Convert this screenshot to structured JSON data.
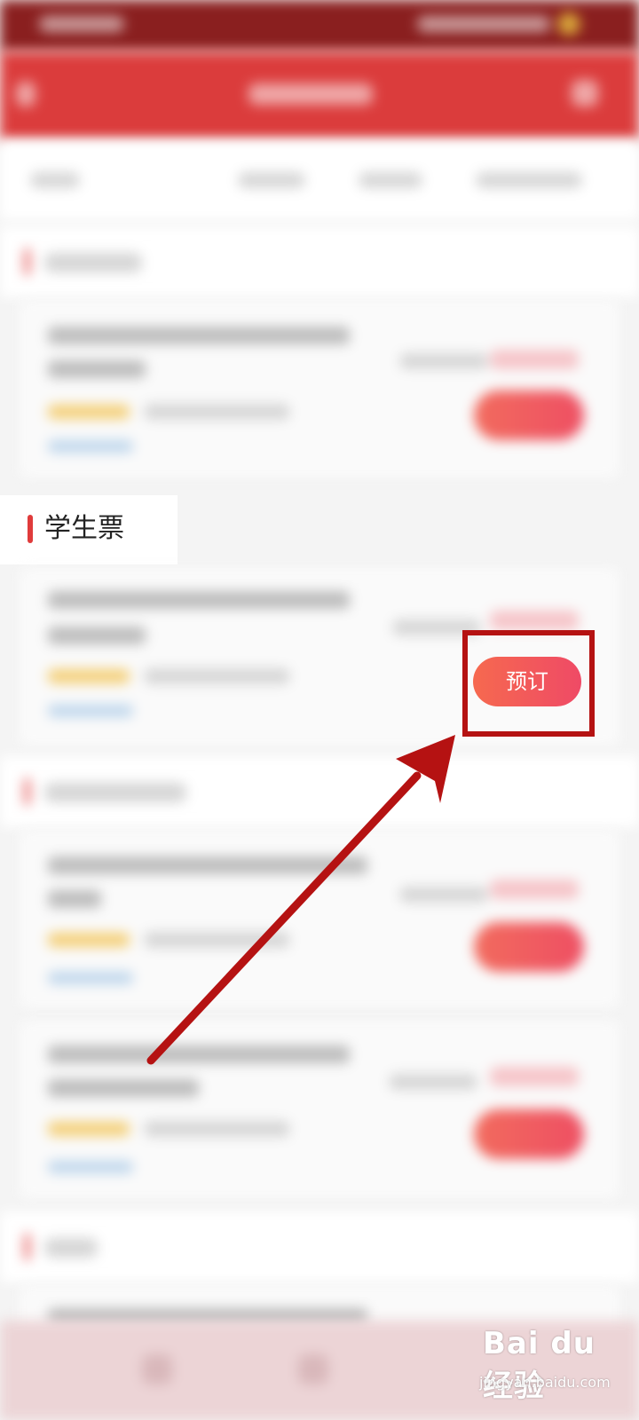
{
  "sections": {
    "student": {
      "title": "学生票",
      "book_button_label": "预订"
    }
  },
  "watermark": {
    "logo": "Bai du 经验",
    "url": "jingyan.baidu.com"
  },
  "colors": {
    "accent": "#e03b3b",
    "highlight": "#b51212",
    "button_start": "#f6694f",
    "button_end": "#ef4a66"
  }
}
